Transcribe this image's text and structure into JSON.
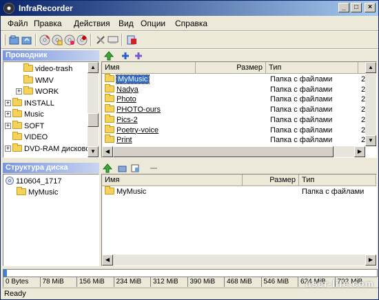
{
  "window": {
    "title": "InfraRecorder",
    "min": "_",
    "max": "□",
    "close": "×"
  },
  "menu": [
    "Файл",
    "Правка",
    "Действия",
    "Вид",
    "Опции",
    "Справка"
  ],
  "explorer_header": "Проводник",
  "explorer_tree": [
    {
      "label": "video-trash",
      "indent": 2,
      "expander": ""
    },
    {
      "label": "WMV",
      "indent": 2,
      "expander": ""
    },
    {
      "label": "WORK",
      "indent": 2,
      "expander": "+"
    },
    {
      "label": "INSTALL",
      "indent": 0,
      "expander": "+"
    },
    {
      "label": "Music",
      "indent": 0,
      "expander": "+"
    },
    {
      "label": "SOFT",
      "indent": 0,
      "expander": "+"
    },
    {
      "label": "VIDEO",
      "indent": 0,
      "expander": ""
    },
    {
      "label": "DVD-RAM дисковод",
      "indent": 0,
      "expander": "+"
    }
  ],
  "file_columns": {
    "name": "Имя",
    "size": "Размер",
    "type": "Тип"
  },
  "files": [
    {
      "name": "MyMusic",
      "type": "Папка с файлами",
      "cut": "2"
    },
    {
      "name": "Nadya",
      "type": "Папка с файлами",
      "cut": "2"
    },
    {
      "name": "Photo",
      "type": "Папка с файлами",
      "cut": "2"
    },
    {
      "name": "PHOTO-ours",
      "type": "Папка с файлами",
      "cut": "2"
    },
    {
      "name": "Pics-2",
      "type": "Папка с файлами",
      "cut": "2"
    },
    {
      "name": "Poetry-voice",
      "type": "Папка с файлами",
      "cut": "2"
    },
    {
      "name": "Print",
      "type": "Папка с файлами",
      "cut": "2"
    }
  ],
  "disc_header": "Структура диска",
  "disc_tree": [
    {
      "label": "110604_1717"
    },
    {
      "label": "MyMusic"
    }
  ],
  "disc_columns": {
    "name": "Имя",
    "size": "Размер",
    "type": "Тип"
  },
  "disc_files": [
    {
      "name": "MyMusic",
      "type": "Папка с файлами"
    }
  ],
  "progress": {
    "fraction": 0.01
  },
  "ruler_labels": [
    "0 Bytes",
    "78 MiB",
    "156 MiB",
    "234 MiB",
    "312 MiB",
    "390 MiB",
    "468 MiB",
    "546 MiB",
    "624 MiB",
    "702 MiB"
  ],
  "status": "Ready",
  "watermark": "user-life.com",
  "colors": {
    "titlebar": "#0a246a",
    "selection": "#316ac5",
    "progress": "#3c7fd8"
  }
}
